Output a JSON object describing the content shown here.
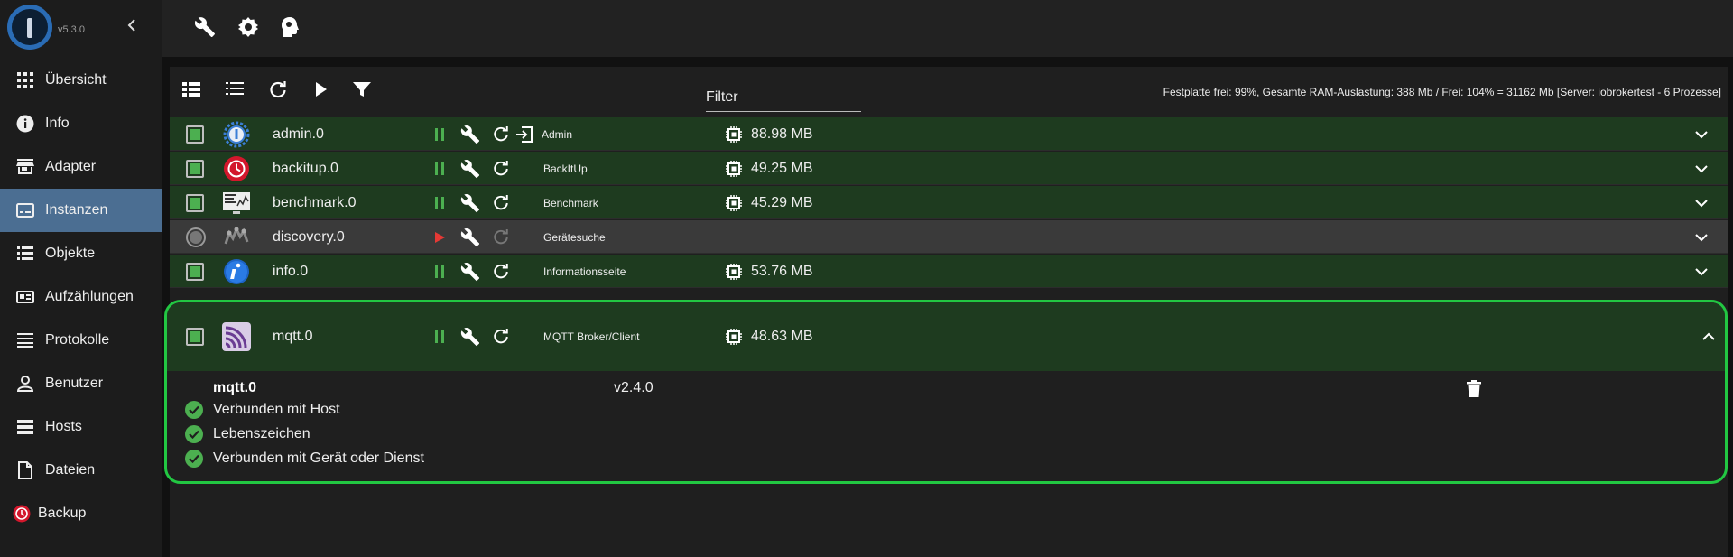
{
  "app": {
    "version": "v5.3.0"
  },
  "sidebar": {
    "items": [
      {
        "label": "Übersicht",
        "icon": "grid-icon"
      },
      {
        "label": "Info",
        "icon": "info-icon"
      },
      {
        "label": "Adapter",
        "icon": "store-icon"
      },
      {
        "label": "Instanzen",
        "icon": "instances-icon",
        "active": true
      },
      {
        "label": "Objekte",
        "icon": "list-icon"
      },
      {
        "label": "Aufzählungen",
        "icon": "enum-icon"
      },
      {
        "label": "Protokolle",
        "icon": "log-icon"
      },
      {
        "label": "Benutzer",
        "icon": "user-icon"
      },
      {
        "label": "Hosts",
        "icon": "hosts-icon"
      },
      {
        "label": "Dateien",
        "icon": "file-icon"
      },
      {
        "label": "Backup",
        "icon": "backup-icon"
      }
    ]
  },
  "topbar": {
    "icons": [
      "wrench-icon",
      "settings-icon",
      "expert-mode-icon"
    ]
  },
  "toolbar": {
    "filter_label": "Filter",
    "system_info": "Festplatte frei: 99%, Gesamte RAM-Auslastung: 388 Mb / Frei: 104% = 31162 Mb [Server: iobrokertest - 6 Prozesse]"
  },
  "instances": [
    {
      "name": "admin.0",
      "title": "Admin",
      "memory": "88.98 MB",
      "running": true,
      "has_link": true
    },
    {
      "name": "backitup.0",
      "title": "BackItUp",
      "memory": "49.25 MB",
      "running": true,
      "has_link": false
    },
    {
      "name": "benchmark.0",
      "title": "Benchmark",
      "memory": "45.29 MB",
      "running": true,
      "has_link": false
    },
    {
      "name": "discovery.0",
      "title": "Gerätesuche",
      "memory": "",
      "running": false,
      "has_link": false
    },
    {
      "name": "info.0",
      "title": "Informationsseite",
      "memory": "53.76 MB",
      "running": true,
      "has_link": false
    }
  ],
  "expanded": {
    "name": "mqtt.0",
    "title": "MQTT Broker/Client",
    "memory": "48.63 MB",
    "detail_title": "mqtt.0",
    "version": "v2.4.0",
    "status": [
      "Verbunden mit Host",
      "Lebenszeichen",
      "Verbunden mit Gerät oder Dienst"
    ]
  },
  "colors": {
    "accent_green": "#22c742",
    "running_row": "#1e3b1f",
    "active_nav": "#4b6e92"
  }
}
